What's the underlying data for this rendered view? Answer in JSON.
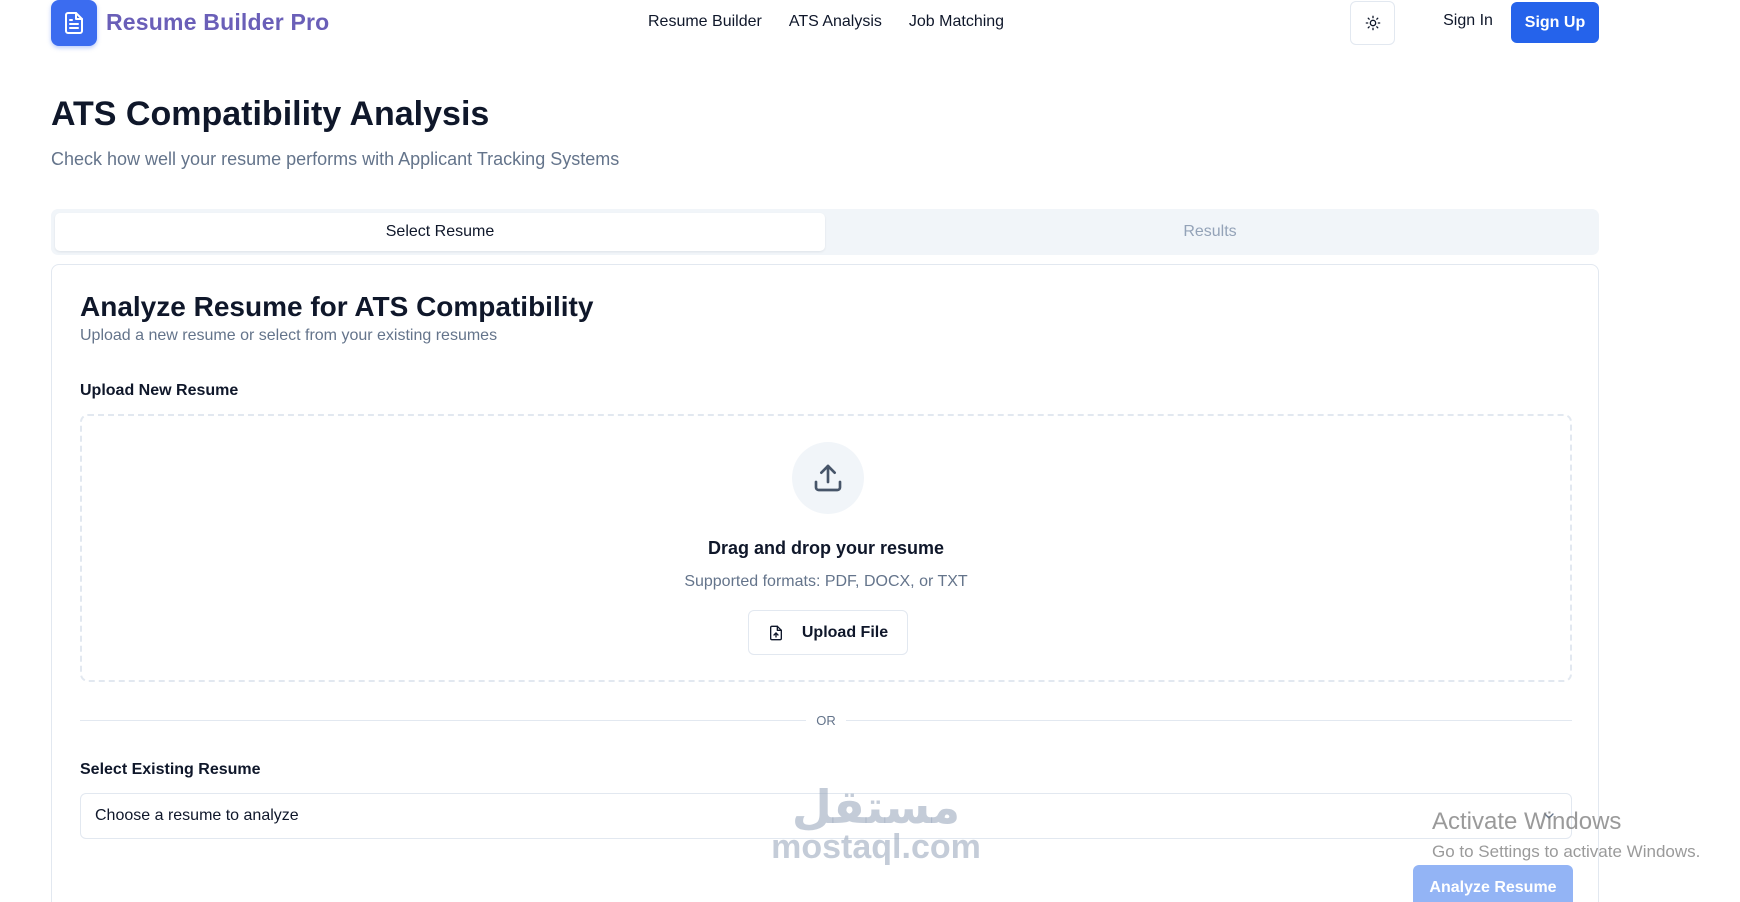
{
  "header": {
    "brand": "Resume Builder Pro",
    "logo_icon": "document-icon",
    "nav": [
      "Resume Builder",
      "ATS Analysis",
      "Job Matching"
    ],
    "theme_icon": "sun-icon",
    "sign_in": "Sign In",
    "sign_up": "Sign Up"
  },
  "page": {
    "title": "ATS Compatibility Analysis",
    "subtitle": "Check how well your resume performs with Applicant Tracking Systems"
  },
  "tabs": [
    {
      "label": "Select Resume",
      "active": true
    },
    {
      "label": "Results",
      "active": false
    }
  ],
  "card": {
    "title": "Analyze Resume for ATS Compatibility",
    "description": "Upload a new resume or select from your existing resumes",
    "upload_label": "Upload New Resume",
    "dropzone": {
      "icon": "upload-icon",
      "title": "Drag and drop your resume",
      "formats": "Supported formats: PDF, DOCX, or TXT",
      "button": "Upload File",
      "button_icon": "file-plus-icon"
    },
    "or_text": "OR",
    "existing_label": "Select Existing Resume",
    "select_value": "Choose a resume to analyze",
    "analyze_button": "Analyze Resume"
  },
  "watermark": {
    "arabic": "مستقل",
    "english": "mostaql.com"
  },
  "activation": {
    "title": "Activate Windows",
    "subtitle": "Go to Settings to activate Windows."
  },
  "colors": {
    "primary": "#2563eb",
    "brand_text": "#6a5fb8",
    "muted": "#64748b",
    "disabled_button": "#93b4f5"
  }
}
